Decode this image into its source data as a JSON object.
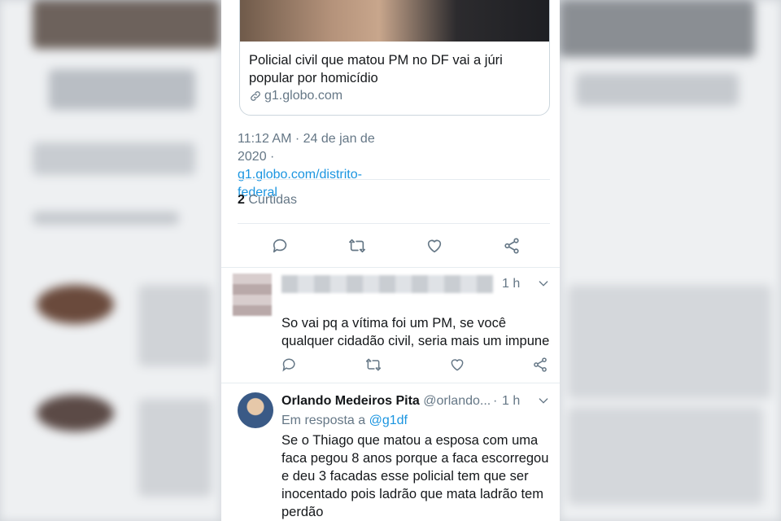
{
  "tweet": {
    "card": {
      "title": "Policial civil que matou PM no DF vai a júri popular por homicídio",
      "domain": "g1.globo.com"
    },
    "timestamp": "11:12 AM · 24 de jan de 2020 ·",
    "source_link": "g1.globo.com/distrito-federal",
    "likes_count": "2",
    "likes_label": "Curtidas"
  },
  "replies": [
    {
      "time": "1 h",
      "text": "So vai pq a vítima foi um PM, se você qualquer cidadão civil, seria mais um impune"
    },
    {
      "name": "Orlando Medeiros Pita",
      "handle": "@orlando...",
      "dot": "·",
      "time": "1 h",
      "in_reply_label": "Em resposta a",
      "in_reply_handle": "@g1df",
      "text": "Se o Thiago que matou a esposa com uma faca pegou 8 anos porque a faca escorregou e deu 3 facadas esse policial tem que ser inocentado pois ladrão que mata ladrão tem perdão"
    }
  ],
  "colors": {
    "accent": "#1b95e0",
    "secondary_text": "#657786",
    "divider": "#e6ecf0"
  },
  "icons": [
    "reply-icon",
    "retweet-icon",
    "like-icon",
    "share-icon",
    "link-icon",
    "chevron-down-icon"
  ]
}
